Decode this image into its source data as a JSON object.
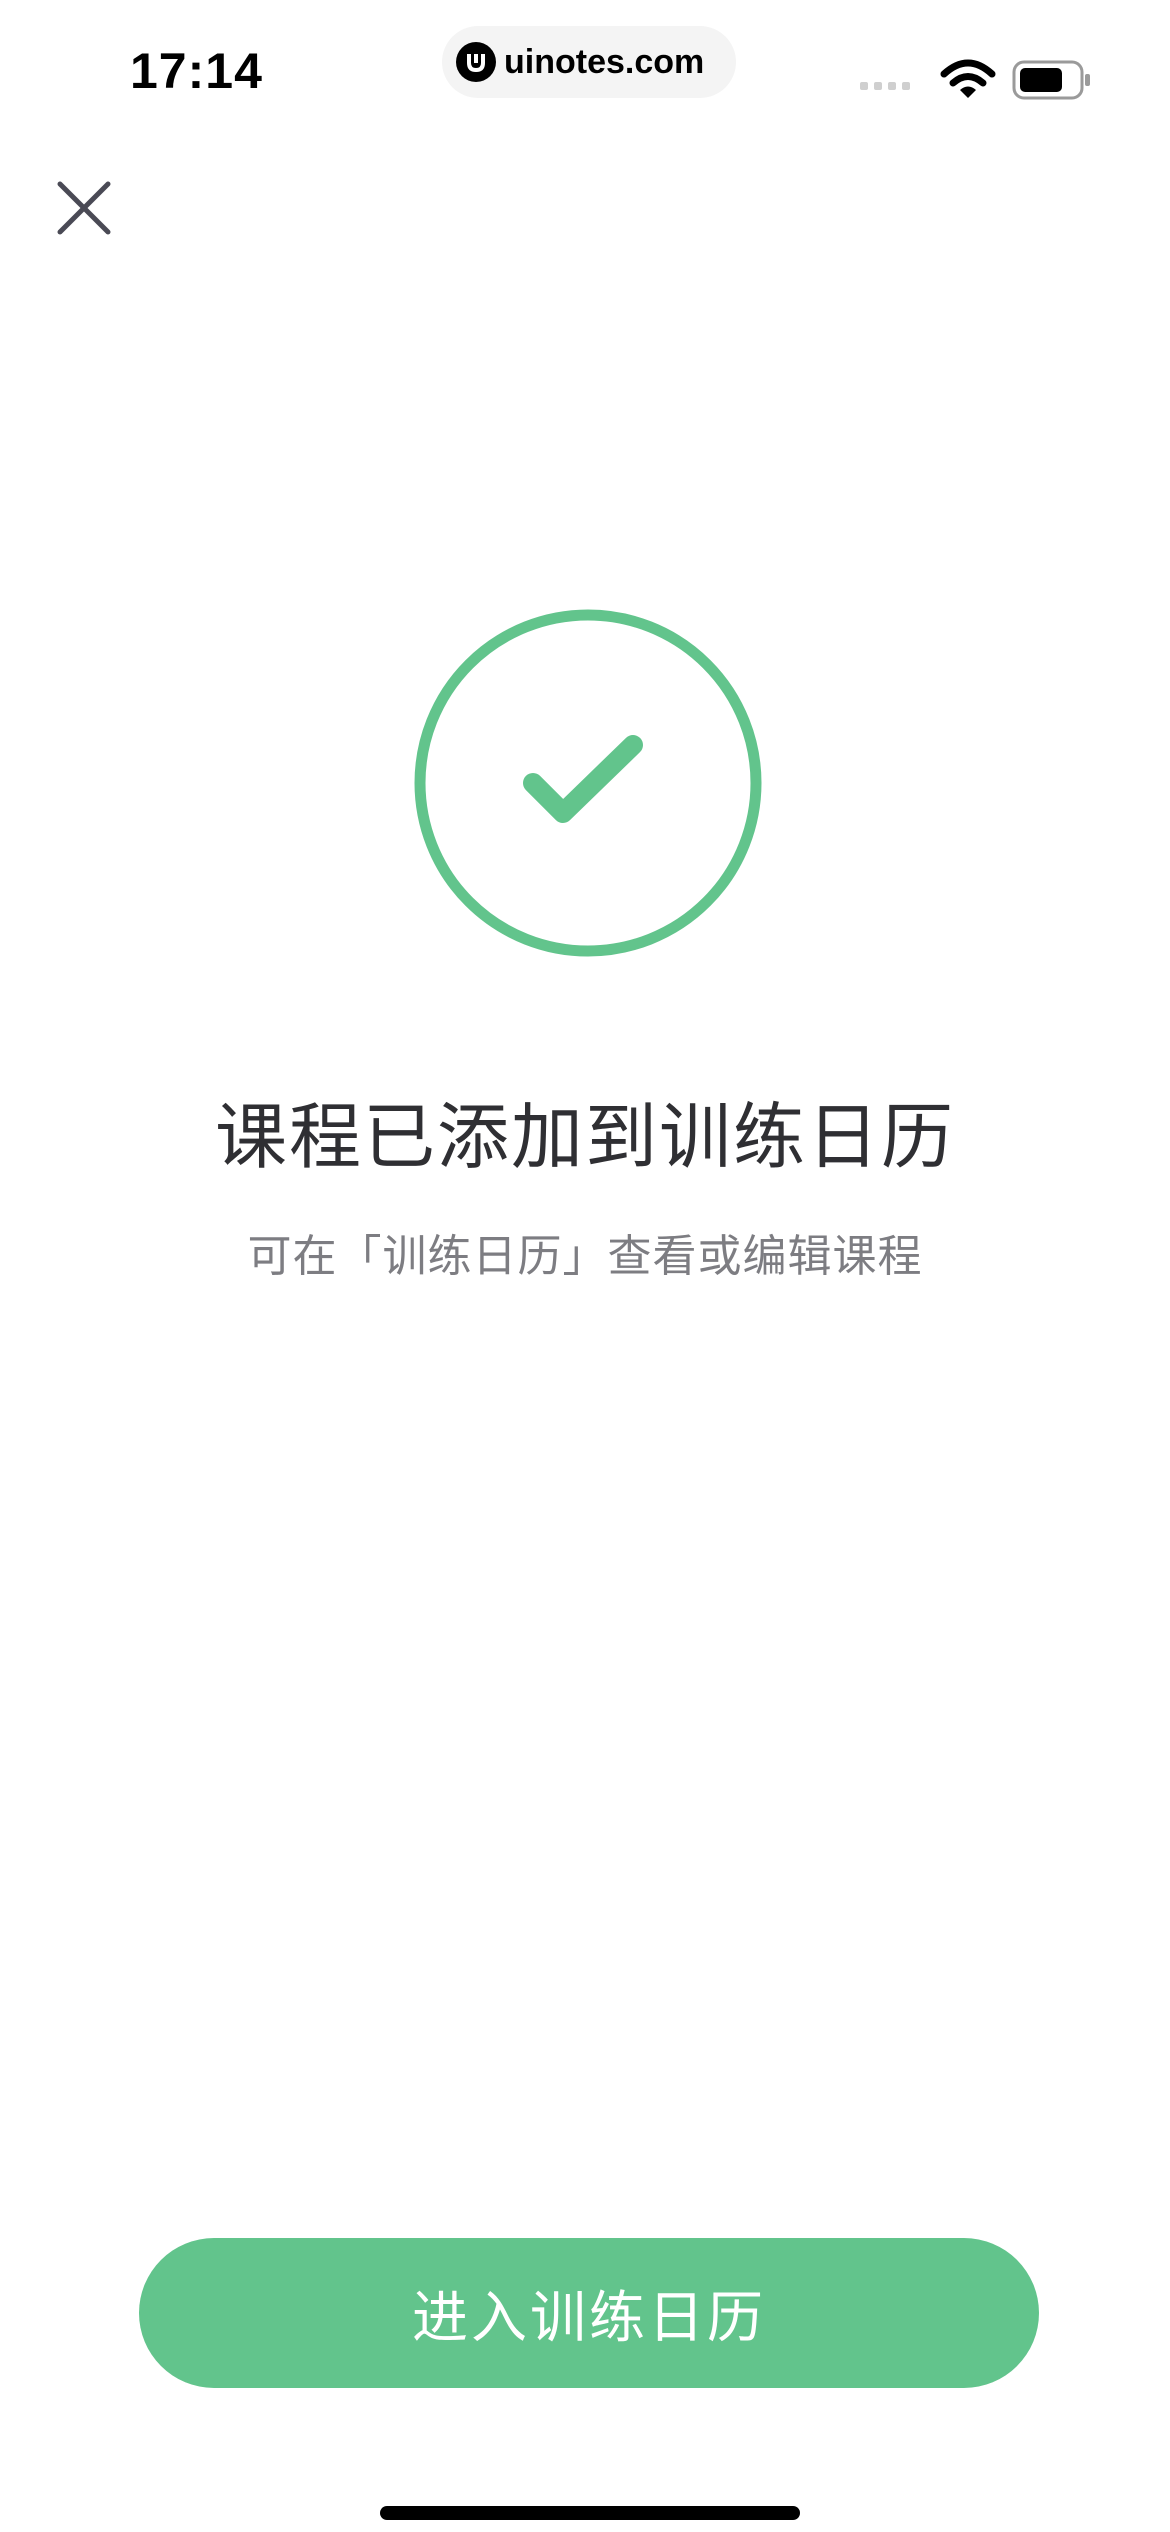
{
  "status_bar": {
    "time": "17:14",
    "url": "uinotes.com"
  },
  "colors": {
    "accent": "#62c48c",
    "title": "#2f2f33",
    "subtitle": "#7d7d82"
  },
  "icons": {
    "close": "close-icon",
    "success": "check-circle-icon"
  },
  "main": {
    "title": "课程已添加到训练日历",
    "subtitle": "可在「训练日历」查看或编辑课程"
  },
  "footer": {
    "cta_label": "进入训练日历"
  }
}
